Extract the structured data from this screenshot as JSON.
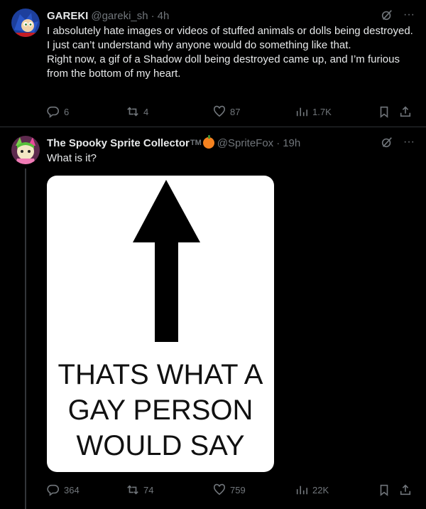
{
  "tweets": [
    {
      "name": "GAREKI",
      "handle": "@gareki_sh",
      "time": "4h",
      "text_lines": [
        "I absolutely hate images or videos of stuffed animals or dolls being destroyed. I just can’t understand why anyone would do something like that.",
        "Right now, a gif of a Shadow doll being destroyed came up, and I’m furious from the bottom of my heart."
      ],
      "replies": "6",
      "retweets": "4",
      "likes": "87",
      "views": "1.7K"
    },
    {
      "name": "The Spooky Sprite Collector",
      "name_badge": "TM",
      "handle": "@SpriteFox",
      "time": "19h",
      "text": "What is it?",
      "image_text": [
        "THATS WHAT A",
        "GAY PERSON",
        "WOULD SAY"
      ],
      "replies": "364",
      "retweets": "74",
      "likes": "759",
      "views": "22K"
    }
  ],
  "icons": {
    "reply": "reply-icon",
    "retweet": "retweet-icon",
    "like": "heart-icon",
    "views": "views-icon",
    "bookmark": "bookmark-icon",
    "share": "share-icon",
    "grok": "grok-icon",
    "more": "more-icon"
  },
  "colors": {
    "background": "#000000",
    "text": "#e7e9ea",
    "muted": "#71767b",
    "divider": "#2f3336"
  }
}
